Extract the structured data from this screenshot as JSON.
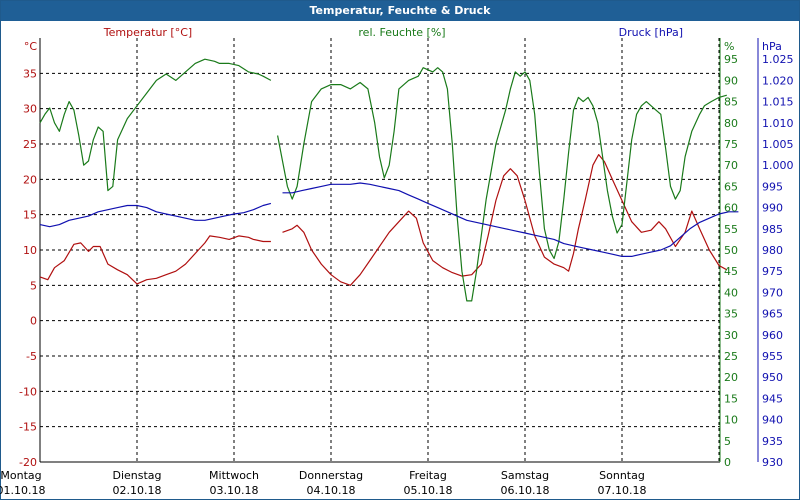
{
  "window": {
    "title": "Temperatur, Feuchte & Druck"
  },
  "colors": {
    "temperature": "#b01010",
    "humidity": "#1a7a1a",
    "pressure": "#1010b0",
    "grid": "#000000",
    "title_bar": "#1f5f96"
  },
  "chart_data": {
    "type": "line",
    "title": "Temperatur, Feuchte & Druck",
    "grid": true,
    "x": {
      "ticks": [
        {
          "day": "Montag",
          "date": "01.10.18"
        },
        {
          "day": "Dienstag",
          "date": "02.10.18"
        },
        {
          "day": "Mittwoch",
          "date": "03.10.18"
        },
        {
          "day": "Donnerstag",
          "date": "04.10.18"
        },
        {
          "day": "Freitag",
          "date": "05.10.18"
        },
        {
          "day": "Samstag",
          "date": "06.10.18"
        },
        {
          "day": "Sonntag",
          "date": "07.10.18"
        }
      ],
      "range": [
        0,
        7
      ]
    },
    "axes": {
      "temperature": {
        "label": "Temperatur [°C]",
        "unit": "°C",
        "range": [
          -20,
          40
        ],
        "step": 5
      },
      "humidity": {
        "label": "rel. Feuchte [%]",
        "unit": "%",
        "range": [
          0,
          100
        ],
        "step": 5
      },
      "pressure": {
        "label": "Druck [hPa]",
        "unit": "hPa",
        "range": [
          930,
          1030
        ],
        "step": 5
      }
    },
    "series": [
      {
        "name": "Temperatur [°C]",
        "axis": "temperature",
        "segments": [
          [
            [
              0,
              6.2
            ],
            [
              0.08,
              5.8
            ],
            [
              0.15,
              7.5
            ],
            [
              0.25,
              8.5
            ],
            [
              0.35,
              10.8
            ],
            [
              0.42,
              11
            ],
            [
              0.5,
              9.8
            ],
            [
              0.55,
              10.5
            ],
            [
              0.62,
              10.5
            ],
            [
              0.7,
              8
            ],
            [
              0.8,
              7.2
            ],
            [
              0.9,
              6.5
            ],
            [
              1.0,
              5.2
            ],
            [
              1.1,
              5.8
            ],
            [
              1.2,
              6
            ],
            [
              1.3,
              6.5
            ],
            [
              1.4,
              7
            ],
            [
              1.5,
              8
            ],
            [
              1.6,
              9.5
            ],
            [
              1.7,
              11
            ],
            [
              1.75,
              12
            ],
            [
              1.85,
              11.8
            ],
            [
              1.95,
              11.5
            ],
            [
              2.05,
              12
            ],
            [
              2.15,
              11.8
            ],
            [
              2.2,
              11.5
            ],
            [
              2.3,
              11.2
            ],
            [
              2.38,
              11.2
            ]
          ],
          [
            [
              2.5,
              12.5
            ],
            [
              2.6,
              13
            ],
            [
              2.65,
              13.5
            ],
            [
              2.72,
              12.5
            ],
            [
              2.8,
              10
            ],
            [
              2.9,
              8
            ],
            [
              3.0,
              6.5
            ],
            [
              3.1,
              5.5
            ],
            [
              3.2,
              5
            ],
            [
              3.3,
              6.5
            ],
            [
              3.4,
              8.5
            ],
            [
              3.5,
              10.5
            ],
            [
              3.6,
              12.5
            ],
            [
              3.7,
              14
            ],
            [
              3.8,
              15.5
            ],
            [
              3.88,
              14.5
            ],
            [
              3.95,
              11
            ],
            [
              4.05,
              8.5
            ],
            [
              4.15,
              7.5
            ],
            [
              4.25,
              6.8
            ],
            [
              4.35,
              6.3
            ],
            [
              4.45,
              6.5
            ],
            [
              4.55,
              8
            ],
            [
              4.62,
              12
            ],
            [
              4.7,
              17
            ],
            [
              4.78,
              20.5
            ],
            [
              4.85,
              21.5
            ],
            [
              4.92,
              20.5
            ],
            [
              5.0,
              17
            ],
            [
              5.1,
              12
            ],
            [
              5.2,
              9
            ],
            [
              5.3,
              8
            ],
            [
              5.4,
              7.5
            ],
            [
              5.45,
              7
            ],
            [
              5.5,
              9.5
            ],
            [
              5.55,
              13
            ],
            [
              5.62,
              17
            ],
            [
              5.7,
              22
            ],
            [
              5.76,
              23.5
            ],
            [
              5.82,
              22.5
            ],
            [
              5.9,
              20
            ],
            [
              6.0,
              17
            ],
            [
              6.1,
              14
            ],
            [
              6.2,
              12.5
            ],
            [
              6.3,
              12.8
            ],
            [
              6.38,
              14
            ],
            [
              6.45,
              13
            ],
            [
              6.55,
              10.5
            ],
            [
              6.65,
              12.5
            ],
            [
              6.72,
              15.5
            ],
            [
              6.8,
              13
            ],
            [
              6.9,
              10
            ],
            [
              7.0,
              7.8
            ],
            [
              7.08,
              7.2
            ]
          ]
        ]
      },
      {
        "name": "rel. Feuchte [%]",
        "axis": "humidity",
        "segments": [
          [
            [
              0,
              80
            ],
            [
              0.05,
              82
            ],
            [
              0.1,
              83.5
            ],
            [
              0.15,
              80
            ],
            [
              0.2,
              78
            ],
            [
              0.25,
              82
            ],
            [
              0.3,
              85
            ],
            [
              0.35,
              83
            ],
            [
              0.4,
              77
            ],
            [
              0.45,
              70
            ],
            [
              0.5,
              71
            ],
            [
              0.55,
              76
            ],
            [
              0.6,
              79
            ],
            [
              0.65,
              78
            ],
            [
              0.7,
              64
            ],
            [
              0.75,
              65
            ],
            [
              0.8,
              76
            ],
            [
              0.9,
              81
            ],
            [
              1.0,
              84
            ],
            [
              1.1,
              87
            ],
            [
              1.2,
              90
            ],
            [
              1.3,
              91.5
            ],
            [
              1.4,
              90
            ],
            [
              1.5,
              92
            ],
            [
              1.6,
              94
            ],
            [
              1.7,
              95
            ],
            [
              1.8,
              94.5
            ],
            [
              1.85,
              94
            ],
            [
              1.95,
              94
            ],
            [
              2.05,
              93.5
            ],
            [
              2.15,
              92
            ],
            [
              2.25,
              91.5
            ],
            [
              2.3,
              91
            ],
            [
              2.38,
              90
            ]
          ],
          [
            [
              2.45,
              77
            ],
            [
              2.5,
              71
            ],
            [
              2.55,
              65
            ],
            [
              2.6,
              62
            ],
            [
              2.65,
              65
            ],
            [
              2.72,
              75
            ],
            [
              2.8,
              85
            ],
            [
              2.9,
              88
            ],
            [
              3.0,
              89
            ],
            [
              3.1,
              89
            ],
            [
              3.2,
              88
            ],
            [
              3.3,
              89.5
            ],
            [
              3.38,
              88
            ],
            [
              3.45,
              80
            ],
            [
              3.5,
              72
            ],
            [
              3.55,
              67
            ],
            [
              3.6,
              70
            ],
            [
              3.65,
              78
            ],
            [
              3.7,
              88
            ],
            [
              3.8,
              90
            ],
            [
              3.9,
              91
            ],
            [
              3.95,
              93
            ],
            [
              4.05,
              92
            ],
            [
              4.1,
              93
            ],
            [
              4.15,
              92
            ],
            [
              4.2,
              88
            ],
            [
              4.25,
              75
            ],
            [
              4.3,
              58
            ],
            [
              4.35,
              45
            ],
            [
              4.4,
              38
            ],
            [
              4.45,
              38
            ],
            [
              4.5,
              45
            ],
            [
              4.6,
              62
            ],
            [
              4.7,
              75
            ],
            [
              4.8,
              83
            ],
            [
              4.85,
              88
            ],
            [
              4.9,
              92
            ],
            [
              4.95,
              91
            ],
            [
              5.0,
              92
            ],
            [
              5.05,
              90
            ],
            [
              5.1,
              82
            ],
            [
              5.15,
              68
            ],
            [
              5.2,
              55
            ],
            [
              5.25,
              50
            ],
            [
              5.3,
              48
            ],
            [
              5.35,
              52
            ],
            [
              5.4,
              62
            ],
            [
              5.45,
              73
            ],
            [
              5.5,
              83
            ],
            [
              5.55,
              86
            ],
            [
              5.6,
              85
            ],
            [
              5.65,
              86
            ],
            [
              5.7,
              84
            ],
            [
              5.75,
              80
            ],
            [
              5.8,
              72
            ],
            [
              5.85,
              64
            ],
            [
              5.9,
              58
            ],
            [
              5.95,
              54
            ],
            [
              6.0,
              56
            ],
            [
              6.05,
              66
            ],
            [
              6.1,
              76
            ],
            [
              6.15,
              82
            ],
            [
              6.2,
              84
            ],
            [
              6.25,
              85
            ],
            [
              6.3,
              84
            ],
            [
              6.35,
              83
            ],
            [
              6.4,
              82
            ],
            [
              6.45,
              74
            ],
            [
              6.5,
              65
            ],
            [
              6.55,
              62
            ],
            [
              6.6,
              64
            ],
            [
              6.65,
              72
            ],
            [
              6.72,
              78
            ],
            [
              6.8,
              82
            ],
            [
              6.85,
              84
            ],
            [
              6.92,
              85
            ],
            [
              7.0,
              86
            ],
            [
              7.08,
              86.5
            ]
          ]
        ]
      },
      {
        "name": "Druck [hPa]",
        "axis": "pressure",
        "segments": [
          [
            [
              0,
              986
            ],
            [
              0.1,
              985.5
            ],
            [
              0.2,
              986
            ],
            [
              0.3,
              987
            ],
            [
              0.4,
              987.5
            ],
            [
              0.5,
              988
            ],
            [
              0.6,
              989
            ],
            [
              0.7,
              989.5
            ],
            [
              0.8,
              990
            ],
            [
              0.9,
              990.5
            ],
            [
              1.0,
              990.5
            ],
            [
              1.1,
              990
            ],
            [
              1.2,
              989
            ],
            [
              1.3,
              988.5
            ],
            [
              1.4,
              988
            ],
            [
              1.5,
              987.5
            ],
            [
              1.6,
              987
            ],
            [
              1.7,
              987
            ],
            [
              1.8,
              987.5
            ],
            [
              1.9,
              988
            ],
            [
              2.0,
              988.5
            ],
            [
              2.1,
              988.8
            ],
            [
              2.2,
              989.5
            ],
            [
              2.3,
              990.5
            ],
            [
              2.38,
              991
            ]
          ],
          [
            [
              2.5,
              993.5
            ],
            [
              2.6,
              993.5
            ],
            [
              2.7,
              994
            ],
            [
              2.8,
              994.5
            ],
            [
              2.9,
              995
            ],
            [
              3.0,
              995.5
            ],
            [
              3.1,
              995.5
            ],
            [
              3.2,
              995.5
            ],
            [
              3.3,
              995.8
            ],
            [
              3.4,
              995.5
            ],
            [
              3.5,
              995
            ],
            [
              3.6,
              994.5
            ],
            [
              3.7,
              994
            ],
            [
              3.8,
              993
            ],
            [
              3.9,
              992
            ],
            [
              4.0,
              991
            ],
            [
              4.1,
              990
            ],
            [
              4.2,
              989
            ],
            [
              4.3,
              988
            ],
            [
              4.4,
              987
            ],
            [
              4.5,
              986.5
            ],
            [
              4.6,
              986
            ],
            [
              4.7,
              985.5
            ],
            [
              4.8,
              985
            ],
            [
              4.9,
              984.5
            ],
            [
              5.0,
              984
            ],
            [
              5.1,
              983.5
            ],
            [
              5.2,
              983
            ],
            [
              5.3,
              982.5
            ],
            [
              5.4,
              981.5
            ],
            [
              5.5,
              981
            ],
            [
              5.6,
              980.5
            ],
            [
              5.7,
              980
            ],
            [
              5.8,
              979.5
            ],
            [
              5.9,
              979
            ],
            [
              6.0,
              978.5
            ],
            [
              6.1,
              978.5
            ],
            [
              6.2,
              979
            ],
            [
              6.3,
              979.5
            ],
            [
              6.4,
              980
            ],
            [
              6.5,
              981
            ],
            [
              6.6,
              983
            ],
            [
              6.7,
              985
            ],
            [
              6.8,
              986.5
            ],
            [
              6.9,
              987.5
            ],
            [
              7.0,
              988.5
            ],
            [
              7.1,
              989
            ],
            [
              7.2,
              989
            ]
          ]
        ]
      }
    ]
  }
}
